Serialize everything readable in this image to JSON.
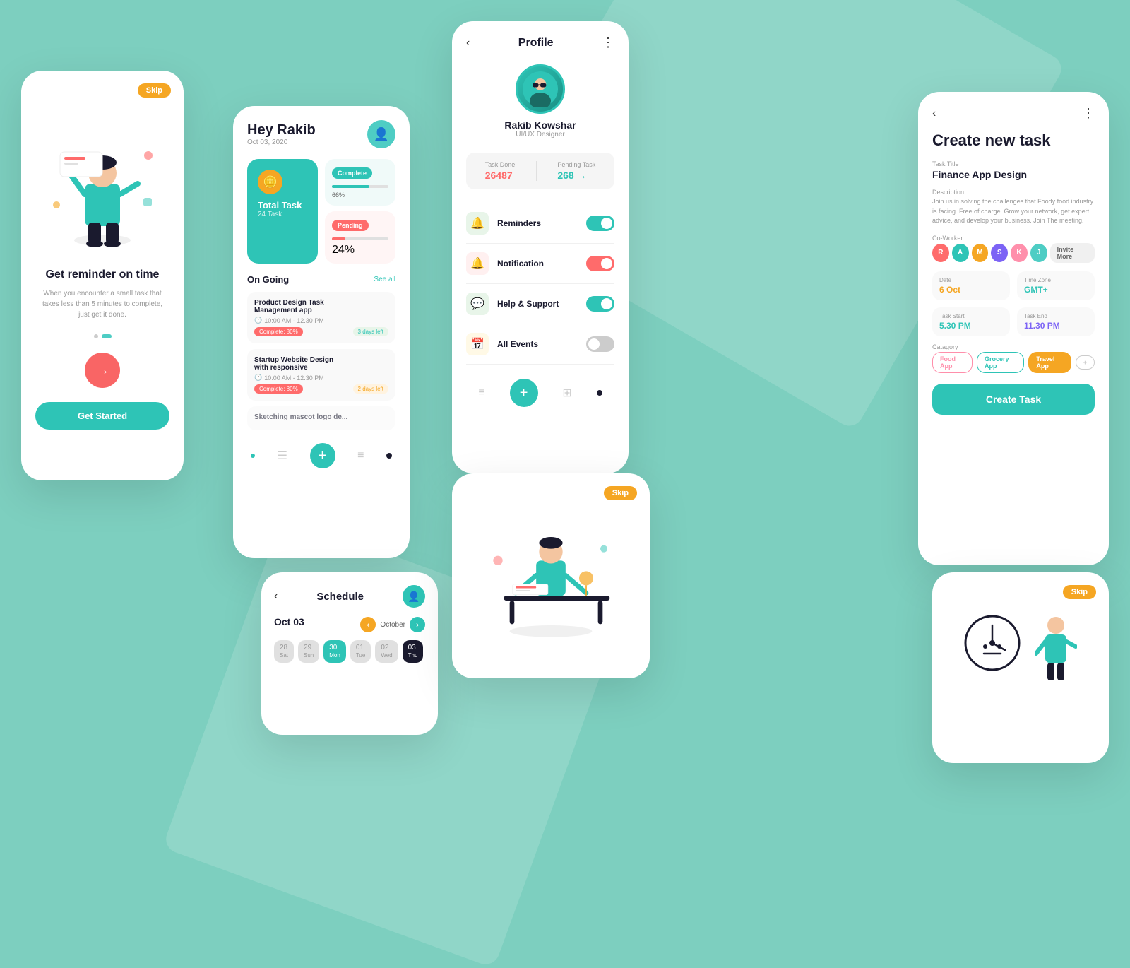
{
  "background": "#7dcfbf",
  "card_reminder": {
    "skip_label": "Skip",
    "title": "Get reminder on time",
    "subtitle": "When you encounter a small task that takes less than 5 minutes to complete, just get it done.",
    "get_started": "Get Started"
  },
  "card_dashboard": {
    "greeting": "Hey Rakib",
    "date": "Oct 03, 2020",
    "total_task_label": "Total Task",
    "total_task_count": "24 Task",
    "complete_label": "Complete",
    "complete_pct": "66%",
    "pending_label": "Pending",
    "pending_pct": "24%",
    "ongoing_label": "On Going",
    "see_all": "See all",
    "tasks": [
      {
        "title": "Product Design Task Management app",
        "time": "10:00 AM - 12.30 PM",
        "complete": "Complete: 80%",
        "days_left": "3 days left"
      },
      {
        "title": "Startup Website Design with responsive",
        "time": "10:00 AM - 12.30 PM",
        "complete": "Complete: 80%",
        "days_left": "2 days left"
      },
      {
        "title": "Sketching mascot logo de...",
        "time": "",
        "complete": "",
        "days_left": ""
      }
    ]
  },
  "card_profile": {
    "title": "Profile",
    "name": "Rakib Kowshar",
    "role": "UI/UX Designer",
    "task_done_label": "Task Done",
    "task_done_value": "26487",
    "pending_label": "Pending Task",
    "pending_value": "268",
    "menu_items": [
      {
        "icon": "🔔",
        "label": "Reminders",
        "toggle": "on"
      },
      {
        "icon": "🔔",
        "label": "Notification",
        "toggle": "red"
      },
      {
        "icon": "💬",
        "label": "Help & Support",
        "toggle": "on"
      },
      {
        "icon": "📅",
        "label": "All Events",
        "toggle": "gray"
      }
    ]
  },
  "card_create": {
    "title": "Create new task",
    "task_title_label": "Task Title",
    "task_title": "Finance App Design",
    "desc_label": "Description",
    "desc": "Join us in solving the challenges that Foody food industry is facing. Free of charge. Grow your network, get expert advice, and develop your business. Join The meeting.",
    "coworker_label": "Co-Worker",
    "invite_label": "Invite More",
    "date_label": "Date",
    "date_value": "6 Oct",
    "timezone_label": "Time Zone",
    "timezone_value": "GMT+",
    "task_start_label": "Task Start",
    "task_start": "5.30 PM",
    "task_end_label": "Task End",
    "task_end": "11.30 PM",
    "category_label": "Catagory",
    "categories": [
      "Food App",
      "Grocery App",
      "Travel App"
    ],
    "create_btn": "Create Task"
  },
  "card_schedule": {
    "title": "Schedule",
    "date": "Oct 03",
    "month": "October"
  },
  "card_reminder2": {
    "skip_label": "Skip"
  },
  "icons": {
    "back_arrow": "‹",
    "more_icon": "⋮",
    "plus": "+",
    "right_arrow": "→",
    "clock": "🕐",
    "map_pin": "📍",
    "calendar": "📅"
  }
}
